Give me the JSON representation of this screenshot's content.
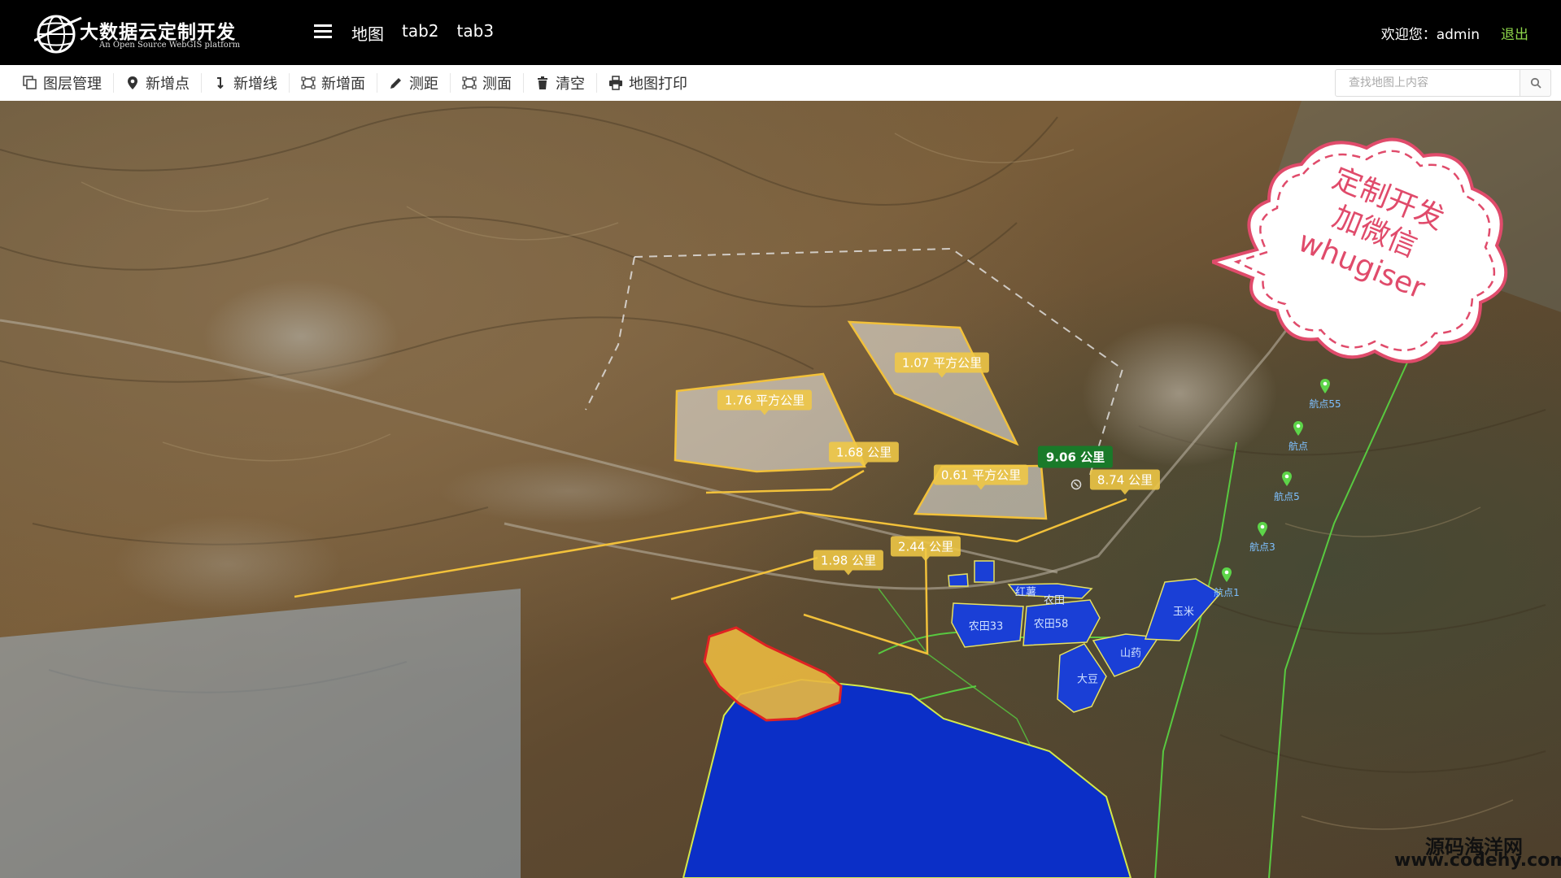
{
  "header": {
    "logo_title": "大数据云定制开发",
    "logo_subtitle": "An Open Source WebGIS platform",
    "nav": [
      "地图",
      "tab2",
      "tab3"
    ],
    "welcome": "欢迎您：admin",
    "logout": "退出"
  },
  "toolbar": {
    "items": [
      {
        "label": "图层管理",
        "icon": "layers-icon"
      },
      {
        "label": "新增点",
        "icon": "map-marker-icon"
      },
      {
        "label": "新增线",
        "icon": "line-icon"
      },
      {
        "label": "新增面",
        "icon": "polygon-icon"
      },
      {
        "label": "测距",
        "icon": "pencil-icon"
      },
      {
        "label": "测面",
        "icon": "area-measure-icon"
      },
      {
        "label": "清空",
        "icon": "trash-icon"
      },
      {
        "label": "地图打印",
        "icon": "print-icon"
      }
    ],
    "search_placeholder": "查找地图上内容"
  },
  "map": {
    "area_labels": [
      "1.07 平方公里",
      "1.76 平方公里",
      "0.61 平方公里"
    ],
    "distance_labels": [
      "1.68 公里",
      "2.44 公里",
      "1.98 公里",
      "8.74 公里"
    ],
    "active_distance": "9.06 公里",
    "fields": [
      "红薯",
      "农田",
      "农田33",
      "农田58",
      "山药",
      "大豆",
      "玉米"
    ],
    "markers": [
      "航点55",
      "航点",
      "航点5",
      "航点3",
      "航点1"
    ],
    "colors": {
      "measure": "#f2c13a",
      "field": "#1a3fd6",
      "selected": "#e03030",
      "lake": "#0b2fc7"
    }
  },
  "cloud": {
    "line1": "定制开发",
    "line2": "加微信",
    "line3": "whugiser"
  },
  "watermark": {
    "line1": "源码海洋网",
    "line2": "www.codehy.com"
  }
}
